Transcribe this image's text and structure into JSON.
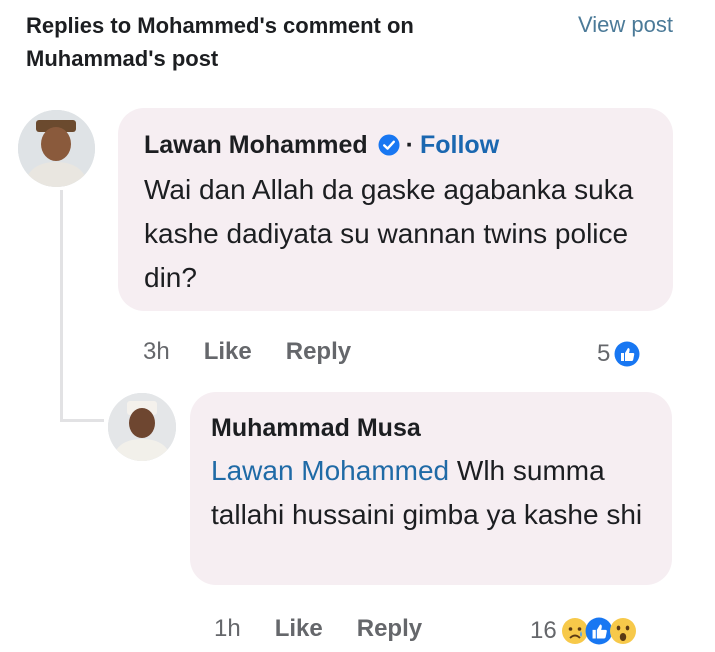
{
  "header": {
    "title": "Replies to Mohammed's comment on Muhammad's post",
    "view_post": "View post"
  },
  "comment": {
    "author": "Lawan Mohammed",
    "verified": true,
    "separator": "·",
    "follow": "Follow",
    "text": "Wai dan Allah da gaske agabanka suka kashe dadiyata su wannan twins police din?",
    "time": "3h",
    "like": "Like",
    "reply": "Reply",
    "reaction_count": "5",
    "reactions": [
      "like-icon"
    ]
  },
  "reply": {
    "author": "Muhammad Musa",
    "mention": "Lawan Mohammed",
    "text": " Wlh summa tallahi hussaini gimba ya kashe shi",
    "time": "1h",
    "like": "Like",
    "reply": "Reply",
    "reaction_count": "16",
    "reactions": [
      "sad-icon",
      "like-icon",
      "wow-icon"
    ]
  },
  "colors": {
    "accent_blue": "#1a67b0",
    "bubble": "#f6eef2",
    "secondary_text": "#65676b"
  }
}
